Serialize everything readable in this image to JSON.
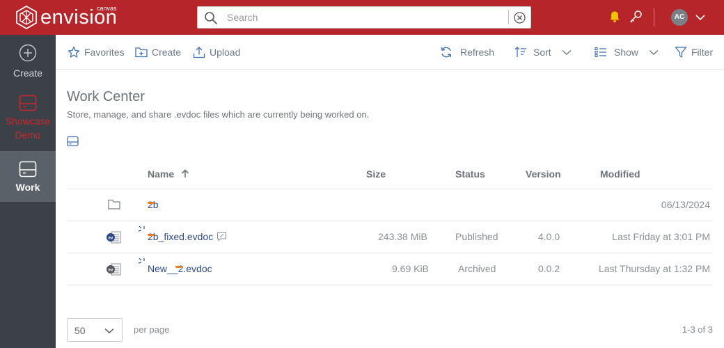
{
  "brand": {
    "name": "envision",
    "sub": "canvas"
  },
  "header": {
    "search_placeholder": "Search",
    "avatar_initials": "AC"
  },
  "sidebar": {
    "items": [
      {
        "label": "Create",
        "icon": "plus-circle-icon"
      },
      {
        "label": "Showcase Demo",
        "icon": "drive-icon"
      },
      {
        "label": "Work",
        "icon": "drive-icon",
        "active": true
      }
    ]
  },
  "toolbar": {
    "favorites": "Favorites",
    "create": "Create",
    "upload": "Upload",
    "refresh": "Refresh",
    "sort": "Sort",
    "show": "Show",
    "filter": "Filter"
  },
  "page": {
    "title": "Work Center",
    "description": "Store, manage, and share .evdoc files which are currently being worked on."
  },
  "table": {
    "columns": {
      "name": "Name",
      "size": "Size",
      "status": "Status",
      "version": "Version",
      "modified": "Modified"
    },
    "rows": [
      {
        "type": "folder",
        "name": "2b",
        "size": "",
        "status": "",
        "version": "",
        "modified": "06/13/2024"
      },
      {
        "type": "evdoc",
        "name": "2b_fixed.evdoc",
        "size": "243.38 MiB",
        "status": "Published",
        "version": "4.0.0",
        "modified": "Last Friday at 3:01 PM"
      },
      {
        "type": "evdoc",
        "name": "New__2.evdoc",
        "size": "9.69 KiB",
        "status": "Archived",
        "version": "0.0.2",
        "modified": "Last Thursday at 1:32 PM"
      }
    ]
  },
  "pagination": {
    "page_size": "50",
    "per_page_label": "per page",
    "range": "1-3 of 3"
  },
  "colors": {
    "header_bg": "#b5252a",
    "sidebar_bg": "#3c4148",
    "sidebar_active_bg": "#5b6168",
    "link": "#2f4a8a",
    "accent_orange": "#f07c1a",
    "bell": "#f3c200"
  }
}
